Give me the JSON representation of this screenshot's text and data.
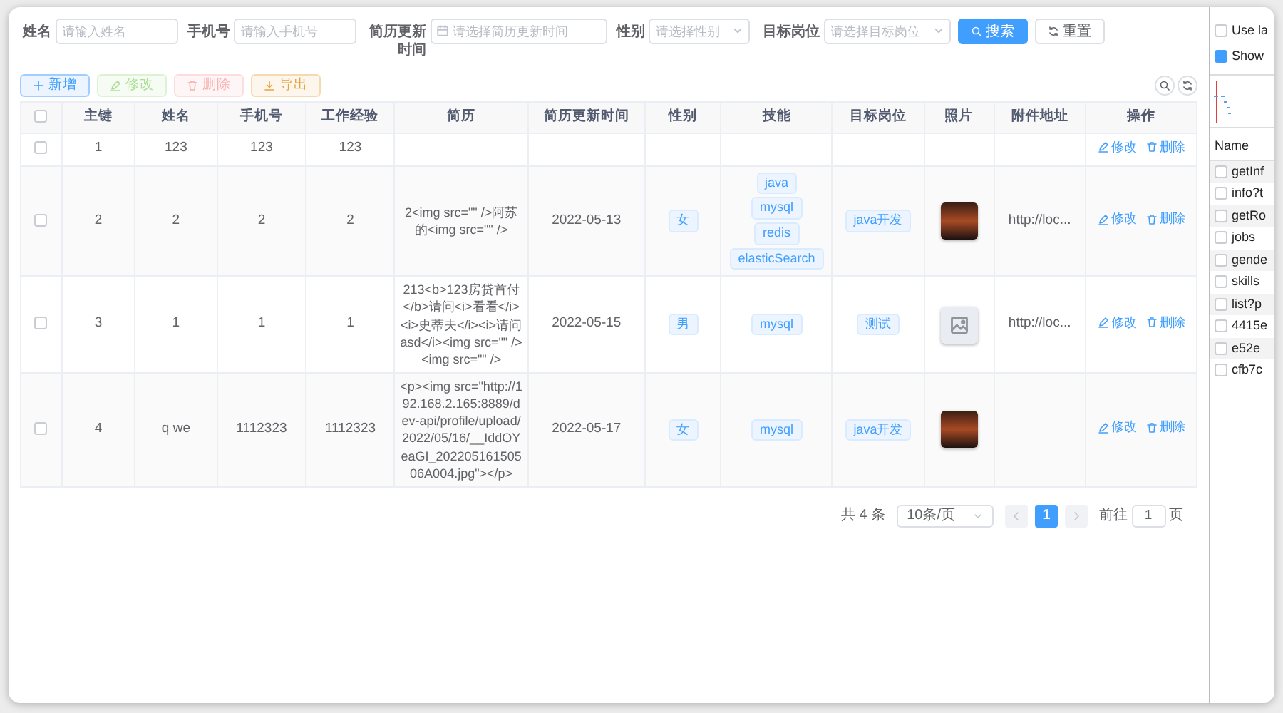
{
  "search_form": {
    "fields": [
      {
        "label": "姓名",
        "kind": "text",
        "placeholder": "请输入姓名"
      },
      {
        "label": "手机号",
        "kind": "text",
        "placeholder": "请输入手机号"
      },
      {
        "label": "简历更新时间",
        "kind": "date",
        "placeholder": "请选择简历更新时间"
      },
      {
        "label": "性别",
        "kind": "select",
        "placeholder": "请选择性别"
      },
      {
        "label": "目标岗位",
        "kind": "select",
        "placeholder": "请选择目标岗位"
      }
    ],
    "buttons": [
      {
        "label": "搜索",
        "kind": "search"
      },
      {
        "label": "重置",
        "kind": "reset"
      }
    ]
  },
  "toolbar": {
    "buttons": [
      {
        "label": "新增",
        "kind": "add",
        "disabled": false
      },
      {
        "label": "修改",
        "kind": "edit",
        "disabled": true
      },
      {
        "label": "删除",
        "kind": "delete",
        "disabled": true
      },
      {
        "label": "导出",
        "kind": "export",
        "disabled": false
      }
    ],
    "tools": [
      {
        "kind": "search"
      },
      {
        "kind": "refresh"
      }
    ]
  },
  "table": {
    "select_all_checked": false,
    "columns": [
      "主键",
      "姓名",
      "手机号",
      "工作经验",
      "简历",
      "简历更新时间",
      "性别",
      "技能",
      "目标岗位",
      "照片",
      "附件地址",
      "操作"
    ],
    "rows": [
      {
        "checked": false,
        "id": "1",
        "name": "123",
        "phone": "123",
        "experience": "123",
        "resume": "",
        "updated": "",
        "gender": "",
        "skills": [],
        "job": "",
        "attachment": "",
        "actions": [
          "修改",
          "删除"
        ]
      },
      {
        "checked": false,
        "id": "2",
        "name": "2",
        "phone": "2",
        "experience": "2",
        "resume": "2<img src=\"\" />阿苏的<img src=\"\" />",
        "updated": "2022-05-13",
        "gender": "女",
        "skills": [
          "java",
          "mysql",
          "redis",
          "elasticSearch"
        ],
        "job": "java开发",
        "photo": {
          "kind": "image"
        },
        "attachment": "http://loc...",
        "actions": [
          "修改",
          "删除"
        ]
      },
      {
        "checked": false,
        "id": "3",
        "name": "1",
        "phone": "1",
        "experience": "1",
        "resume": "213<b>123房贷首付</b>请问<i>看看</i><i>史蒂夫</i><i>请问asd</i><img src=\"\" /><img src=\"\" />",
        "updated": "2022-05-15",
        "gender": "男",
        "skills": [
          "mysql"
        ],
        "job": "测试",
        "photo": {
          "kind": "placeholder"
        },
        "attachment": "http://loc...",
        "actions": [
          "修改",
          "删除"
        ]
      },
      {
        "checked": false,
        "id": "4",
        "name": "q we",
        "phone": "1112323",
        "experience": "1112323",
        "resume": "<p><img src=\"http://192.168.2.165:8889/dev-api/profile/upload/2022/05/16/__IddOYeaGI_20220516150506A004.jpg\"></p>",
        "updated": "2022-05-17",
        "gender": "女",
        "skills": [
          "mysql"
        ],
        "job": "java开发",
        "photo": {
          "kind": "image"
        },
        "attachment": "",
        "actions": [
          "修改",
          "删除"
        ]
      }
    ]
  },
  "pagination": {
    "total": "共 4 条",
    "page_size": "10条/页",
    "pages": [
      {
        "label": "1",
        "selected": true
      }
    ],
    "goto_label": "前往",
    "goto_value": "1",
    "goto_suffix": "页"
  },
  "devtools": {
    "options": [
      {
        "label": "Use la",
        "checked": false
      },
      {
        "label": "Show",
        "checked": true
      }
    ],
    "name_header": "Name",
    "requests": [
      {
        "label": "getInf",
        "checked": false
      },
      {
        "label": "info?t",
        "checked": false
      },
      {
        "label": "getRo",
        "checked": false
      },
      {
        "label": "jobs",
        "checked": false
      },
      {
        "label": "gende",
        "checked": false
      },
      {
        "label": "skills",
        "checked": false
      },
      {
        "label": "list?p",
        "checked": false
      },
      {
        "label": "4415e",
        "checked": false
      },
      {
        "label": "e52e",
        "checked": false
      },
      {
        "label": "cfb7c",
        "checked": false
      }
    ]
  }
}
